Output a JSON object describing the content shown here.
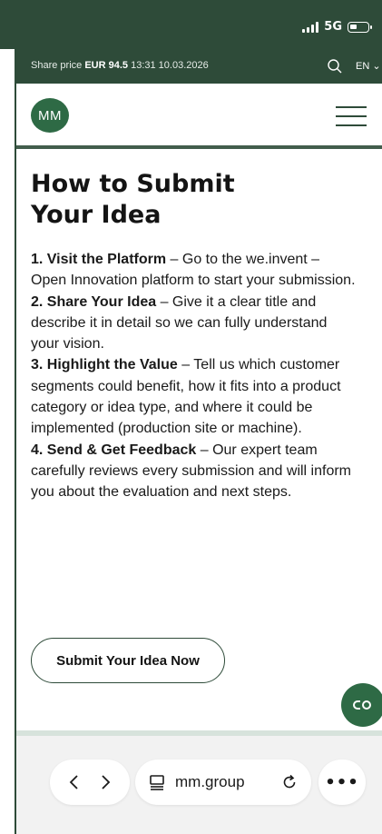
{
  "status_bar": {
    "network": "5G",
    "bg_color": "#2e4b39"
  },
  "share_bar": {
    "label": "Share price",
    "value": "EUR 94.5",
    "timestamp": "13:31 10.03.2026",
    "language": "EN"
  },
  "header": {
    "logo_text": "MM",
    "menu_icon": "hamburger-menu-icon"
  },
  "content": {
    "title": "How to Submit Your Idea",
    "steps": [
      {
        "heading": "1. Visit the Platform",
        "text": " – Go to the we.invent – Open Innovation platform to start your submission."
      },
      {
        "heading": "2. Share Your Idea",
        "text": " – Give it a clear title and describe it in detail so we can fully understand your vision."
      },
      {
        "heading": "3. Highlight the Value",
        "text": " – Tell us which customer segments could benefit, how it fits into a product category or idea type, and where it could be implemented (production site or machine)."
      },
      {
        "heading": "4. Send & Get Feedback",
        "text": " – Our expert team carefully reviews every submission and will inform you about the evaluation and next steps."
      }
    ],
    "cta_label": "Submit Your Idea Now"
  },
  "browser": {
    "url": "mm.group",
    "more_label": "•••"
  },
  "colors": {
    "brand_green": "#2e4b39",
    "logo_green": "#2e6a45"
  }
}
